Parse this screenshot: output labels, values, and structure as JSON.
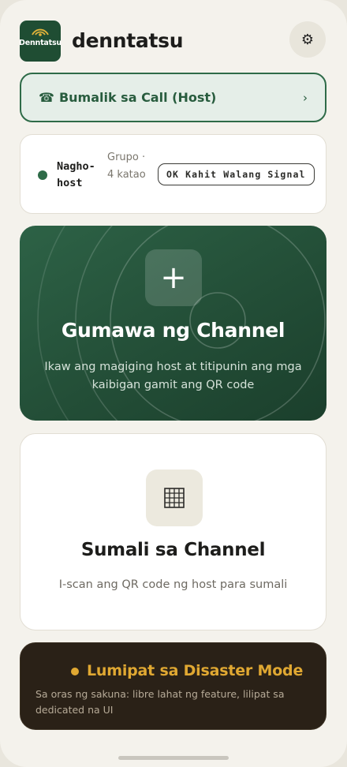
{
  "app": {
    "logo_text": "Denntatsu",
    "title": "denntatsu",
    "settings_icon": "gear-icon"
  },
  "rejoin": {
    "icon": "☎",
    "label": "Bumalik sa Call (Host)",
    "chevron": "›"
  },
  "status": {
    "role": "Nagho-host",
    "group": "Grupo · 4 katao",
    "badge": "OK Kahit Walang Signal"
  },
  "create": {
    "icon": "+",
    "title": "Gumawa ng Channel",
    "description": "Ikaw ang magiging host at titipunin ang mga kaibigan gamit ang QR code"
  },
  "join": {
    "icon": "qr-grid-icon",
    "title": "Sumali sa Channel",
    "description": "I-scan ang QR code ng host para sumali"
  },
  "disaster": {
    "title": "Lumipat sa Disaster Mode",
    "description": "Sa oras ng sakuna: libre lahat ng feature, lilipat sa dedicated na UI"
  },
  "colors": {
    "brand_green": "#2e6b48",
    "background": "#f4f2ec",
    "disaster_bg": "#2a2117",
    "disaster_accent": "#e0a832"
  }
}
